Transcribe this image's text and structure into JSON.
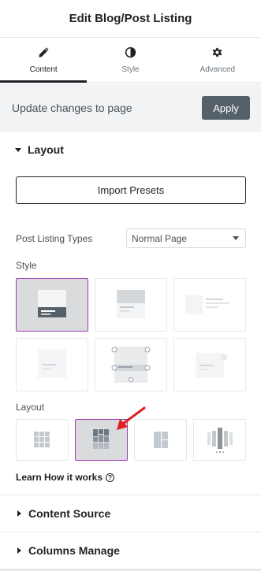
{
  "header": {
    "title": "Edit Blog/Post Listing"
  },
  "tabs": [
    {
      "label": "Content",
      "icon": "pencil-icon",
      "active": true
    },
    {
      "label": "Style",
      "icon": "contrast-icon",
      "active": false
    },
    {
      "label": "Advanced",
      "icon": "gear-icon",
      "active": false
    }
  ],
  "update_bar": {
    "text": "Update changes to page",
    "apply_label": "Apply"
  },
  "layout_section": {
    "title": "Layout",
    "import_label": "Import Presets",
    "post_listing_types_label": "Post Listing Types",
    "post_listing_types_value": "Normal Page",
    "style_label": "Style",
    "style_selected_index": 0,
    "layout_label": "Layout",
    "layout_selected_index": 1,
    "learn_label": "Learn How it works"
  },
  "sections": [
    {
      "title": "Content Source"
    },
    {
      "title": "Columns Manage"
    }
  ],
  "colors": {
    "accent": "#a13fb4",
    "annotation_arrow": "#e02020",
    "apply_bg": "#556068"
  }
}
